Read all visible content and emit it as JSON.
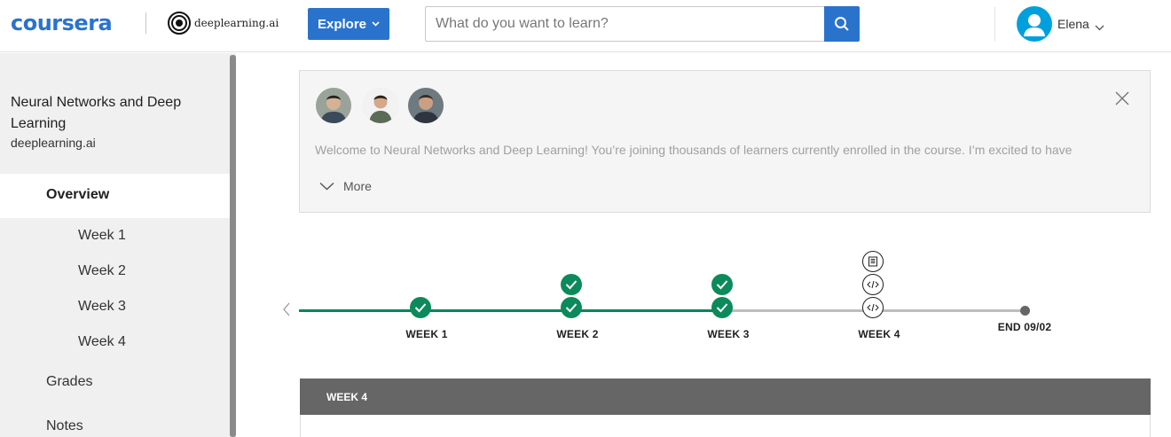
{
  "header": {
    "brand": "coursera",
    "partner": "deeplearning.ai",
    "explore_label": "Explore",
    "search_placeholder": "What do you want to learn?",
    "user_name": "Elena"
  },
  "sidebar": {
    "course_title": "Neural Networks and Deep Learning",
    "course_org": "deeplearning.ai",
    "overview_label": "Overview",
    "weeks": [
      "Week 1",
      "Week 2",
      "Week 3",
      "Week 4"
    ],
    "grades_label": "Grades",
    "notes_label": "Notes"
  },
  "welcome": {
    "text": "Welcome to Neural Networks and Deep Learning! You’re joining thousands of learners currently enrolled in the course. I’m excited to have",
    "more_label": "More"
  },
  "timeline": {
    "labels": [
      "WEEK 1",
      "WEEK 2",
      "WEEK 3",
      "WEEK 4",
      "END 09/02"
    ]
  },
  "week_section": {
    "title": "WEEK 4"
  },
  "colors": {
    "brand_blue": "#2a73cc",
    "progress_green": "#00875a",
    "avatar_blue": "#00a0dc"
  }
}
